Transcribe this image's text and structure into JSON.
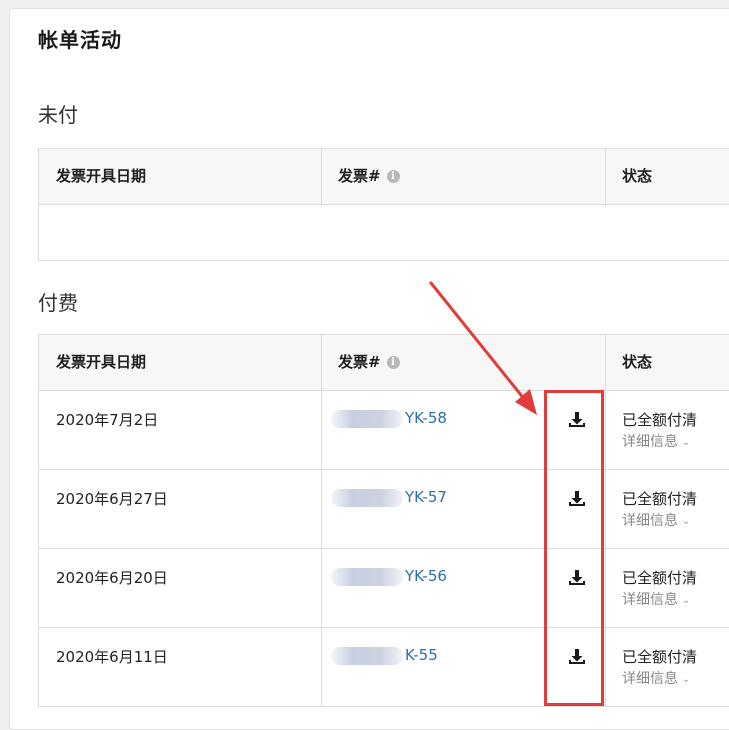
{
  "page": {
    "title": "帐单活动"
  },
  "unpaid": {
    "section_title": "未付",
    "headers": {
      "date": "发票开具日期",
      "invoice": "发票#",
      "status": "状态"
    }
  },
  "paid": {
    "section_title": "付费",
    "headers": {
      "date": "发票开具日期",
      "invoice": "发票#",
      "status": "状态"
    },
    "rows": [
      {
        "date": "2020年7月2日",
        "invoice": "YK-58",
        "status": "已全额付清",
        "details": "详细信息"
      },
      {
        "date": "2020年6月27日",
        "invoice": "YK-57",
        "status": "已全额付清",
        "details": "详细信息"
      },
      {
        "date": "2020年6月20日",
        "invoice": "YK-56",
        "status": "已全额付清",
        "details": "详细信息"
      },
      {
        "date": "2020年6月11日",
        "invoice": "K-55",
        "status": "已全额付清",
        "details": "详细信息"
      }
    ]
  },
  "icons": {
    "info": "info-icon",
    "download": "download-icon",
    "chevron": "chevron-down-icon"
  },
  "colors": {
    "link": "#2f6fa8",
    "annotation": "#e23b3b"
  }
}
